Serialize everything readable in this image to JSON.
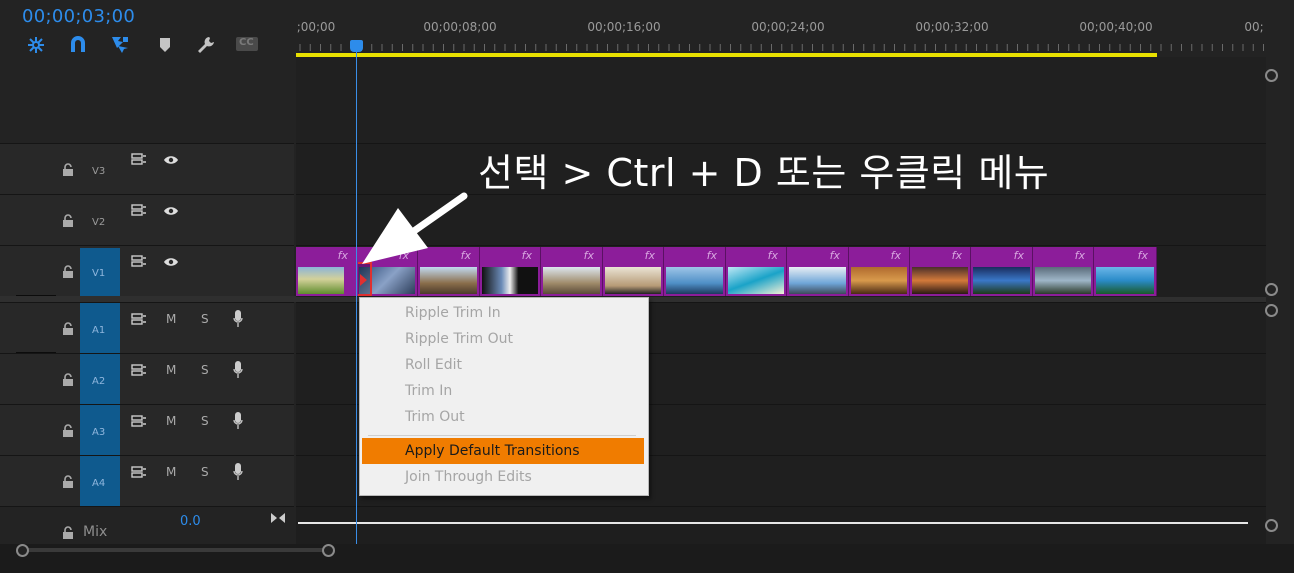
{
  "header": {
    "timecode": "00;00;03;00",
    "tools": [
      "insert-overwrite-icon",
      "snap-magnet-icon",
      "linked-selection-icon",
      "add-marker-icon",
      "settings-wrench-icon",
      "captions-cc-icon"
    ],
    "captions_label": "CC"
  },
  "ruler": {
    "labels": [
      ";00;00",
      "00;00;08;00",
      "00;00;16;00",
      "00;00;24;00",
      "00;00;32;00",
      "00;00;40;00",
      "00;"
    ]
  },
  "tracks": {
    "video": [
      {
        "name": "V3"
      },
      {
        "name": "V2"
      },
      {
        "name": "V1",
        "targeted": true
      }
    ],
    "audio": [
      {
        "name": "A1",
        "m": "M",
        "s": "S"
      },
      {
        "name": "A2",
        "m": "M",
        "s": "S"
      },
      {
        "name": "A3",
        "m": "M",
        "s": "S"
      },
      {
        "name": "A4",
        "m": "M",
        "s": "S"
      }
    ],
    "mix": {
      "label": "Mix",
      "value": "0.0"
    }
  },
  "clips": {
    "fx_label": "fx",
    "count": 14
  },
  "annotation": {
    "text": "선택 > Ctrl + D 또는 우클릭 메뉴"
  },
  "context_menu": {
    "items": [
      {
        "label": "Ripple Trim In",
        "enabled": false
      },
      {
        "label": "Ripple Trim Out",
        "enabled": false
      },
      {
        "label": "Roll Edit",
        "enabled": false
      },
      {
        "label": "Trim In",
        "enabled": false
      },
      {
        "label": "Trim Out",
        "enabled": false
      },
      {
        "label": "Apply Default Transitions",
        "enabled": true,
        "highlighted": true
      },
      {
        "label": "Join Through Edits",
        "enabled": false
      }
    ]
  },
  "colors": {
    "accent_blue": "#2d8ceb",
    "clip_purple": "#8c1d9a",
    "menu_highlight": "#f07c00",
    "work_area_yellow": "#e8e000"
  }
}
